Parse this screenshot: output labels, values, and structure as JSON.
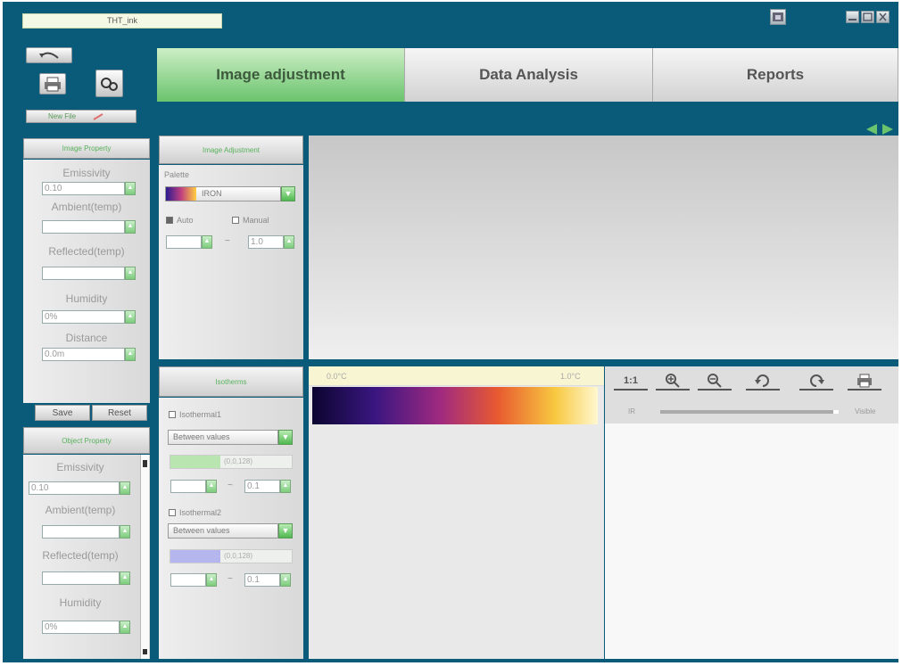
{
  "header": {
    "file_name": "THT_ink"
  },
  "toolbar": {
    "new_file_label": "New File",
    "undo_icon": "undo-arrow-icon",
    "print_icon": "printer-icon",
    "camera_icon": "camera-icon"
  },
  "tabs": [
    {
      "label": "Image adjustment",
      "active": true
    },
    {
      "label": "Data Analysis",
      "active": false
    },
    {
      "label": "Reports",
      "active": false
    }
  ],
  "image_property": {
    "title": "Image Property",
    "emissivity_label": "Emissivity",
    "emissivity_value": "0.10",
    "ambient_label": "Ambient(temp)",
    "ambient_value": "",
    "reflected_label": "Reflected(temp)",
    "reflected_value": "",
    "humidity_label": "Humidity",
    "humidity_value": "0%",
    "distance_label": "Distance",
    "distance_value": "0.0m",
    "save_label": "Save",
    "reset_label": "Reset"
  },
  "object_property": {
    "title": "Object Property",
    "emissivity_label": "Emissivity",
    "emissivity_value": "0.10",
    "ambient_label": "Ambient(temp)",
    "ambient_value": "",
    "reflected_label": "Reflected(temp)",
    "reflected_value": "",
    "humidity_label": "Humidity",
    "humidity_value": "0%"
  },
  "image_adjustment": {
    "title": "Image Adjustment",
    "palette_label": "Palette",
    "palette_value": "IRON",
    "auto_label": "Auto",
    "auto_checked": true,
    "manual_label": "Manual",
    "manual_checked": false,
    "range_min": "",
    "range_separator": "~",
    "range_max": "1.0"
  },
  "isotherms": {
    "title": "Isotherms",
    "iso1_label": "Isothermal1",
    "iso1_mode": "Between values",
    "iso1_color_text": "(0,0,128)",
    "iso1_min": "",
    "iso1_sep": "~",
    "iso1_max": "0.1",
    "iso2_label": "Isothermal2",
    "iso2_mode": "Between values",
    "iso2_color_text": "(0,0,128)",
    "iso2_min": "",
    "iso2_sep": "~",
    "iso2_max": "0.1"
  },
  "colorbar": {
    "min_label": "0.0°C",
    "max_label": "1.0°C"
  },
  "view_tools": {
    "zoom_ratio": "1:1",
    "ir_label": "IR",
    "visible_label": "Visible",
    "blend_fraction": 0.97
  },
  "colors": {
    "background": "#0a5a7a",
    "accent_green": "#6ac46d",
    "palette_gradient": [
      "#0b0530",
      "#3a1680",
      "#a02a80",
      "#e85a30",
      "#f8c840",
      "#fff8d0"
    ]
  }
}
